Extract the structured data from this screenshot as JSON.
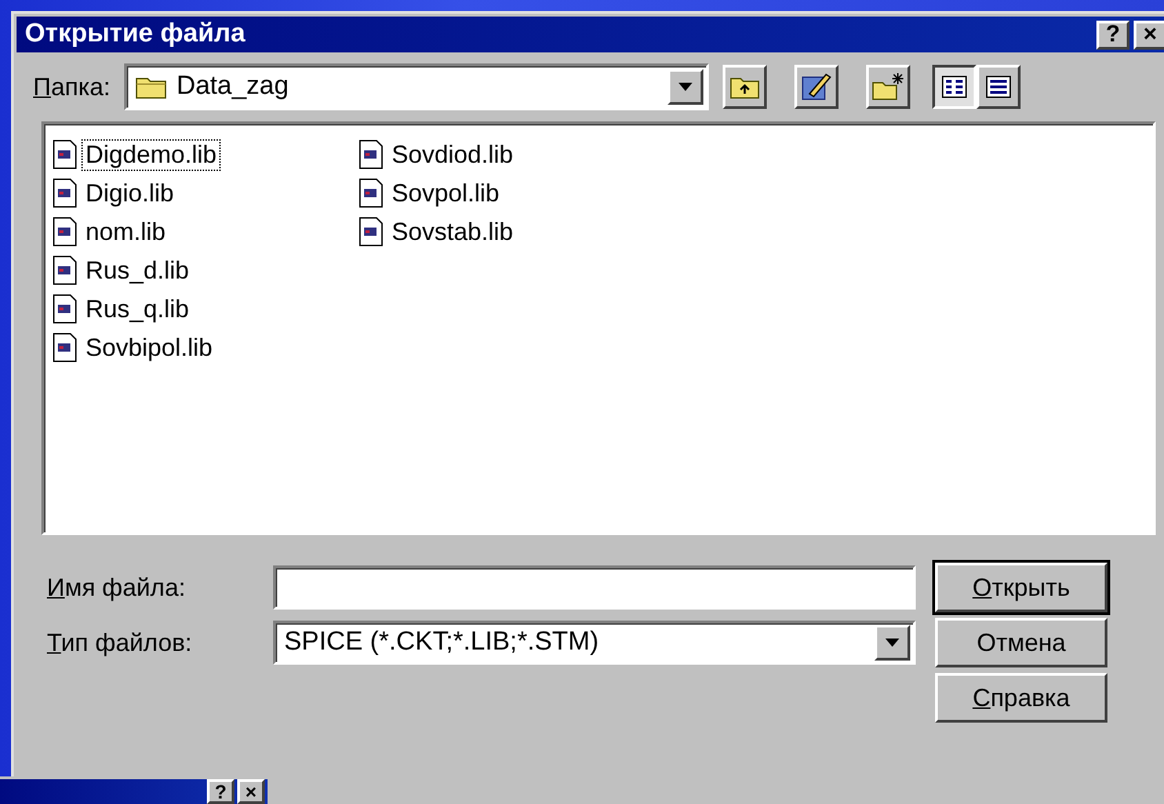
{
  "window": {
    "title": "Открытие файла",
    "help_button": "?",
    "close_button": "×"
  },
  "folder": {
    "label": "Папка:",
    "value": "Data_zag"
  },
  "files": [
    {
      "name": "Digdemo.lib",
      "focused": true
    },
    {
      "name": "Digio.lib",
      "focused": false
    },
    {
      "name": "nom.lib",
      "focused": false
    },
    {
      "name": "Rus_d.lib",
      "focused": false
    },
    {
      "name": "Rus_q.lib",
      "focused": false
    },
    {
      "name": "Sovbipol.lib",
      "focused": false
    },
    {
      "name": "Sovdiod.lib",
      "focused": false
    },
    {
      "name": "Sovpol.lib",
      "focused": false
    },
    {
      "name": "Sovstab.lib",
      "focused": false
    }
  ],
  "file_name": {
    "label": "Имя файла:"
  },
  "file_type": {
    "label": "Тип файлов:",
    "value": "SPICE (*.CKT;*.LIB;*.STM)"
  },
  "buttons": [
    {
      "label": "Открыть",
      "default": true
    },
    {
      "label": "Отмена",
      "default": false
    },
    {
      "label": "Справка",
      "default": false
    }
  ],
  "view_buttons": [
    {
      "kind": "list",
      "selected": true
    },
    {
      "kind": "details",
      "selected": false
    }
  ],
  "second_window": {
    "help_button": "?",
    "close_button": "×"
  }
}
